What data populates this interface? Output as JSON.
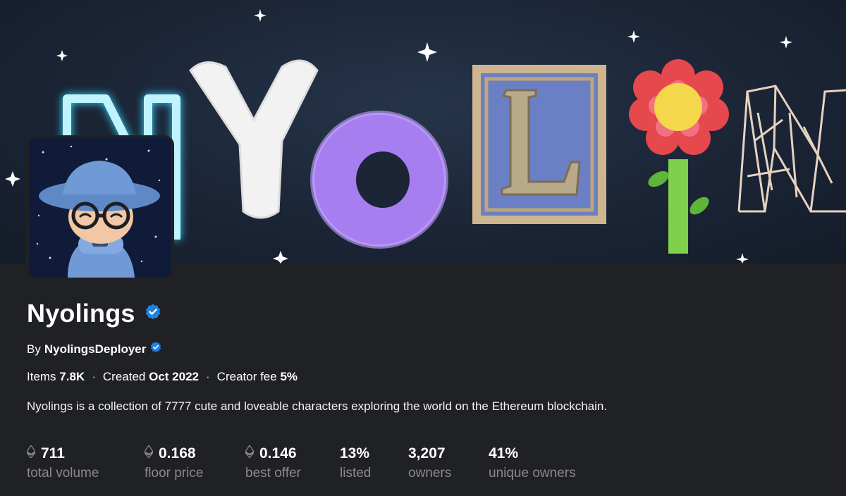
{
  "collection": {
    "name": "Nyolings",
    "creator_prefix": "By",
    "creator": "NyolingsDeployer",
    "items_label": "Items",
    "items_value": "7.8K",
    "created_label": "Created",
    "created_value": "Oct 2022",
    "fee_label": "Creator fee",
    "fee_value": "5%",
    "separator": "·",
    "description": "Nyolings is a collection of 7777 cute and loveable characters exploring the world on the Ethereum blockchain."
  },
  "stats": [
    {
      "value": "711",
      "label": "total volume",
      "icon": "eth-icon"
    },
    {
      "value": "0.168",
      "label": "floor price",
      "icon": "eth-icon"
    },
    {
      "value": "0.146",
      "label": "best offer",
      "icon": "eth-icon"
    },
    {
      "value": "13%",
      "label": "listed"
    },
    {
      "value": "3,207",
      "label": "owners"
    },
    {
      "value": "41%",
      "label": "unique owners"
    }
  ],
  "colors": {
    "background": "#202124",
    "verified": "#2081e2",
    "muted_label": "#8a8a8e"
  }
}
